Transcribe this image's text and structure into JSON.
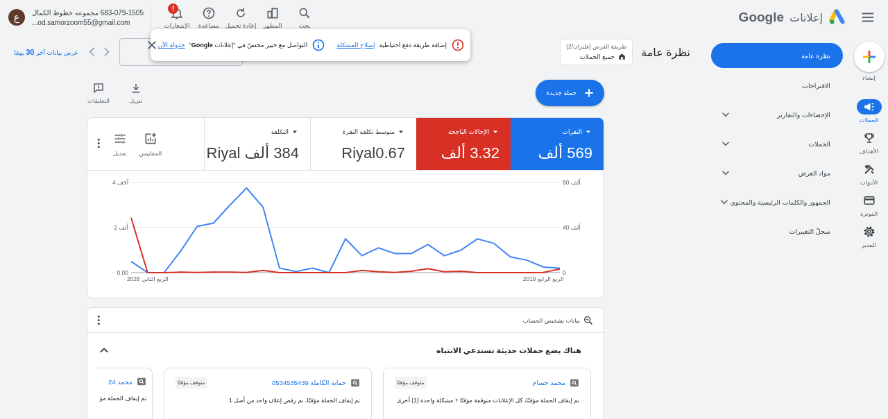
{
  "header": {
    "product_label": "إعلانات",
    "brand": "Google",
    "tools": [
      {
        "kind": "search",
        "label": "بحث"
      },
      {
        "kind": "appearance",
        "label": "المظهر"
      },
      {
        "kind": "reload",
        "label": "إعادة تحميل"
      },
      {
        "kind": "help",
        "label": "مساعدة"
      },
      {
        "kind": "notifications",
        "label": "الإشعارات",
        "badge": "!"
      }
    ],
    "account": {
      "name": "683-079-1505 مجموعه خطوط الكمال",
      "email": "...od.samorzoom55@gmail.com",
      "avatar_letter": "ع"
    }
  },
  "rail": {
    "items": [
      {
        "kind": "create",
        "label": "إنشاء"
      },
      {
        "kind": "campaigns",
        "label": "الحملات",
        "selected": true
      },
      {
        "kind": "goals",
        "label": "الأهداف",
        "selected": false
      },
      {
        "kind": "tools",
        "label": "الأدوات",
        "selected": false
      },
      {
        "kind": "billing",
        "label": "الفوترة",
        "selected": false
      },
      {
        "kind": "admin",
        "label": "المدير",
        "selected": false
      }
    ]
  },
  "nav": {
    "items": [
      {
        "kind": "link",
        "label": "نظرة عامة",
        "selected": true
      },
      {
        "kind": "link",
        "label": "الاقتراحات",
        "selected": false
      },
      {
        "kind": "group",
        "label": "الإحصاءات والتقارير",
        "selected": false,
        "expanded": false
      },
      {
        "kind": "group",
        "label": "الحملات",
        "selected": false,
        "expanded": false
      },
      {
        "kind": "group",
        "label": "مواد العرض",
        "selected": false,
        "expanded": false
      },
      {
        "kind": "group",
        "label": "الجمهور والكلمات الرئيسية والمحتوى",
        "selected": false,
        "expanded": false
      },
      {
        "kind": "link",
        "label": "سجلّ التغييرات",
        "selected": false
      }
    ]
  },
  "page": {
    "title": "نظرة عامة",
    "view_filter": {
      "label": "طريقة العرض (فلتران/2)",
      "value": "جميع الحملات"
    },
    "date_range_link": "عرض بيانات آخر **30** يومًا",
    "toast": {
      "items": [
        {
          "kind": "error",
          "text": "إضافة طريقة دفع احتياطية",
          "link": "إصلاح المشكلة"
        },
        {
          "kind": "info",
          "text": "التواصل مع خبير مختصّ في \"إعلانات **Google**\"",
          "link": "جدولة الآن"
        }
      ]
    },
    "actions": {
      "new_campaign": "حملة جديدة",
      "download": "تنزيل",
      "feedback": "التعليقات"
    }
  },
  "performance": {
    "metrics": [
      {
        "label": "النقرات",
        "value": "569 ألف",
        "selected": true,
        "color": "#1a73e8"
      },
      {
        "label": "الإحالات الناجحة",
        "value": "3.32 ألف",
        "selected": true,
        "color": "#d93025"
      },
      {
        "label": "متوسط تكلفة النقرة",
        "value": "Riyal0.67",
        "selected": false
      },
      {
        "label": "التكلفة",
        "value": "384 ألف Riyal",
        "selected": false
      }
    ],
    "tools": [
      {
        "kind": "metrics",
        "label": "المقاييس"
      },
      {
        "kind": "adjust",
        "label": "تعديل"
      }
    ],
    "chart_data": {
      "type": "line",
      "categories": [
        null,
        "الربع الثاني 2026",
        null,
        null,
        null,
        null,
        null,
        null,
        null,
        null,
        null,
        null,
        null,
        null,
        null,
        null,
        null,
        null,
        null,
        null,
        null,
        null,
        null,
        null,
        null,
        "الربع الرابع 2019",
        null
      ],
      "ylim": [
        0,
        4
      ],
      "yticks": [
        {
          "value": 0,
          "label": "0.00"
        },
        {
          "value": 2,
          "label": "2 ألف"
        },
        {
          "value": 4,
          "label": "4 آلاف"
        }
      ],
      "y2lim": [
        0,
        80
      ],
      "y2ticks": [
        {
          "value": 0,
          "label": "0"
        },
        {
          "value": 40,
          "label": "40 ألف"
        },
        {
          "value": 80,
          "label": "80 ألف"
        }
      ],
      "series": [
        {
          "color": "#4285f4",
          "axis": "y2",
          "values": [
            10,
            0,
            0,
            19,
            41,
            44,
            60,
            75,
            58,
            4,
            1,
            4,
            0,
            30,
            15,
            22,
            17,
            17,
            25,
            15,
            20,
            30,
            26,
            14,
            11,
            5,
            4
          ]
        },
        {
          "color": "#d93025",
          "values": [
            2.44,
            0,
            0,
            0.02,
            0.01,
            0.02,
            0.02,
            0.01,
            0.1,
            0,
            0,
            0,
            0,
            0,
            0.1,
            0.04,
            0.01,
            0.06,
            0.18,
            0.04,
            0.06,
            0,
            0,
            0,
            0,
            0.01,
            0.16
          ]
        }
      ]
    }
  },
  "diagnostics": {
    "label": "بيانات تشخيص الحساب",
    "heading": "هناك بضع حملات حديثة تستدعي الانتباه",
    "expanded": true,
    "campaigns": [
      {
        "kind": "full",
        "name": "محمد حسام",
        "status": "متوقف مؤقتًا",
        "message": "تم إيقاف الحملة مؤقتًا، كل الإعلانات متوقفة مؤقتًا + مشكلة واحدة (1) أخرى"
      },
      {
        "kind": "full",
        "name": "حماية الكاملة 0534535439",
        "status": "متوقف مؤقتًا",
        "message": "تم إيقاف الحملة مؤقتًا، تم رفض إعلان واحد من أصل 1"
      },
      {
        "kind": "partial",
        "name": "محمد 24",
        "message": "تم إيقاف الحملة مؤ"
      }
    ]
  }
}
